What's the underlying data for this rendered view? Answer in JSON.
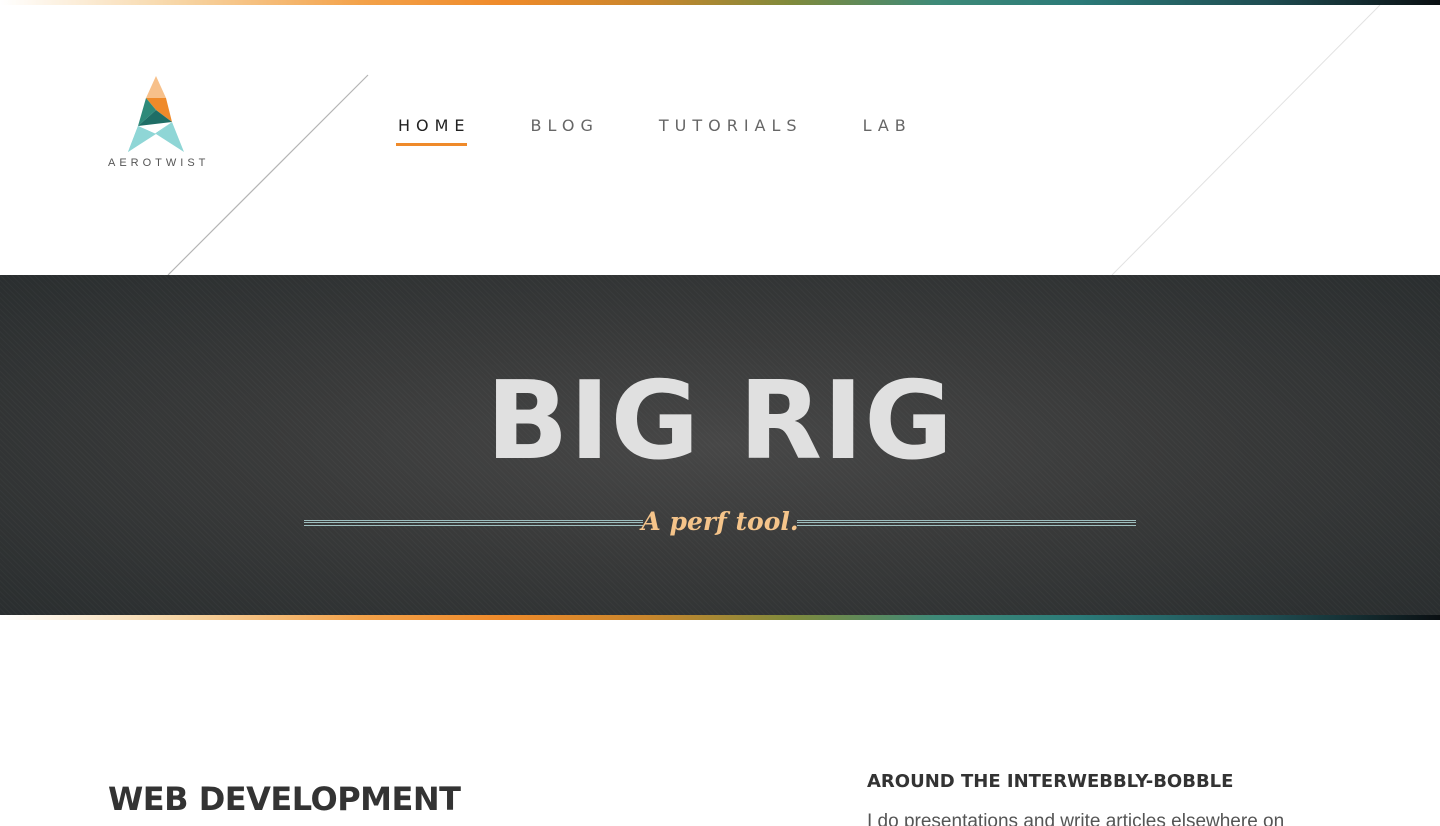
{
  "logo": {
    "text": "AEROTWIST"
  },
  "nav": {
    "items": [
      {
        "label": "HOME",
        "active": true
      },
      {
        "label": "BLOG",
        "active": false
      },
      {
        "label": "TUTORIALS",
        "active": false
      },
      {
        "label": "LAB",
        "active": false
      }
    ]
  },
  "hero": {
    "title": "BIG RIG",
    "tagline": "A perf tool."
  },
  "main": {
    "section_title": "WEB DEVELOPMENT"
  },
  "sidebar": {
    "title": "AROUND THE INTERWEBBLY-BOBBLE",
    "text": "I do presentations and write articles elsewhere on"
  },
  "colors": {
    "accent": "#ef8a2a",
    "hero_title": "#e0e0e0",
    "tagline": "#f5c48a",
    "hero_bg": "#393a3a"
  }
}
